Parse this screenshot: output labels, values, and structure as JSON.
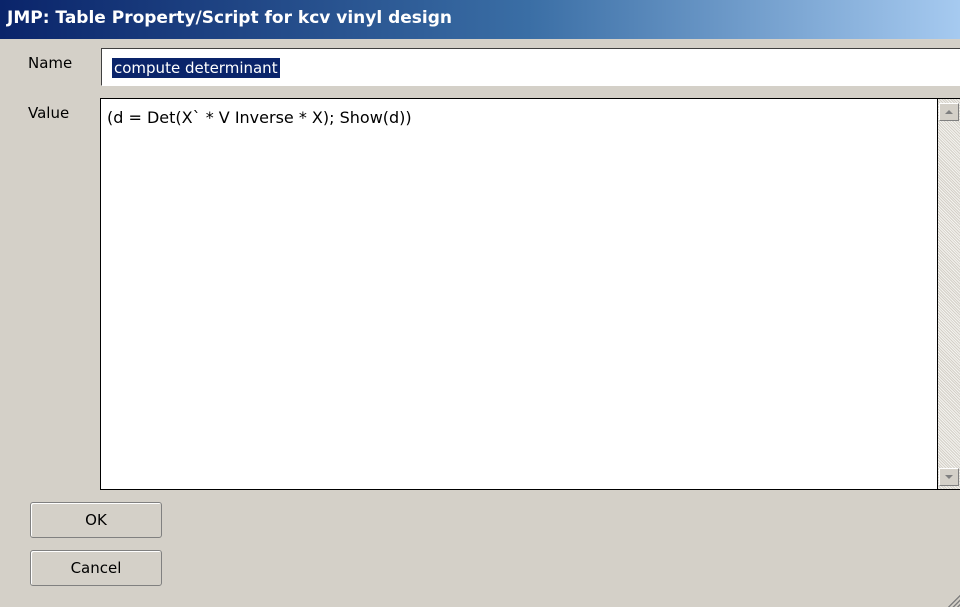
{
  "window": {
    "title": "JMP: Table Property/Script for kcv vinyl design"
  },
  "form": {
    "name_label": "Name",
    "name_value": "compute determinant",
    "value_label": "Value",
    "value_text": "(d = Det(X` * V Inverse * X); Show(d))"
  },
  "buttons": {
    "ok_label": "OK",
    "cancel_label": "Cancel"
  },
  "colors": {
    "title_bar": "#0a246a",
    "selection": "#0a246a",
    "window_bg": "#d4d0c8"
  },
  "icons": [
    "scroll-up-arrow-icon",
    "scroll-down-arrow-icon",
    "resize-grip-icon"
  ]
}
